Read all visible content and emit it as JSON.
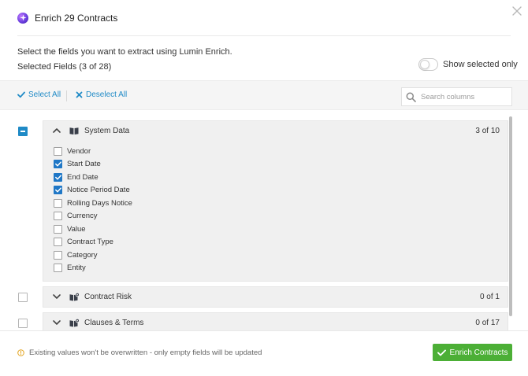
{
  "header": {
    "title": "Enrich 29 Contracts"
  },
  "intro": {
    "instruction": "Select the fields you want to extract using Lumin Enrich.",
    "selected_count": "Selected Fields (3 of 28)",
    "toggle_label": "Show selected only",
    "toggle_on": false
  },
  "toolbar": {
    "select_all": "Select All",
    "deselect_all": "Deselect All",
    "search_placeholder": "Search columns"
  },
  "groups": [
    {
      "name": "System Data",
      "count": "3 of 10",
      "expanded": true,
      "state": "partial",
      "icon": "book-icon",
      "fields": [
        {
          "label": "Vendor",
          "checked": false
        },
        {
          "label": "Start Date",
          "checked": true
        },
        {
          "label": "End Date",
          "checked": true
        },
        {
          "label": "Notice Period Date",
          "checked": true
        },
        {
          "label": "Rolling Days Notice",
          "checked": false
        },
        {
          "label": "Currency",
          "checked": false
        },
        {
          "label": "Value",
          "checked": false
        },
        {
          "label": "Contract Type",
          "checked": false
        },
        {
          "label": "Category",
          "checked": false
        },
        {
          "label": "Entity",
          "checked": false
        }
      ]
    },
    {
      "name": "Contract Risk",
      "count": "0 of 1",
      "expanded": false,
      "state": "none",
      "icon": "book-gear-icon"
    },
    {
      "name": "Clauses & Terms",
      "count": "0 of 17",
      "expanded": false,
      "state": "none",
      "icon": "book-gear-icon"
    }
  ],
  "footer": {
    "note": "Existing values won't be overwritten - only empty fields will be updated",
    "enrich_button": "Enrich Contracts"
  },
  "colors": {
    "accent": "#1f8ac6",
    "primary_button": "#4caf36",
    "logo": "#6b3fe0"
  }
}
